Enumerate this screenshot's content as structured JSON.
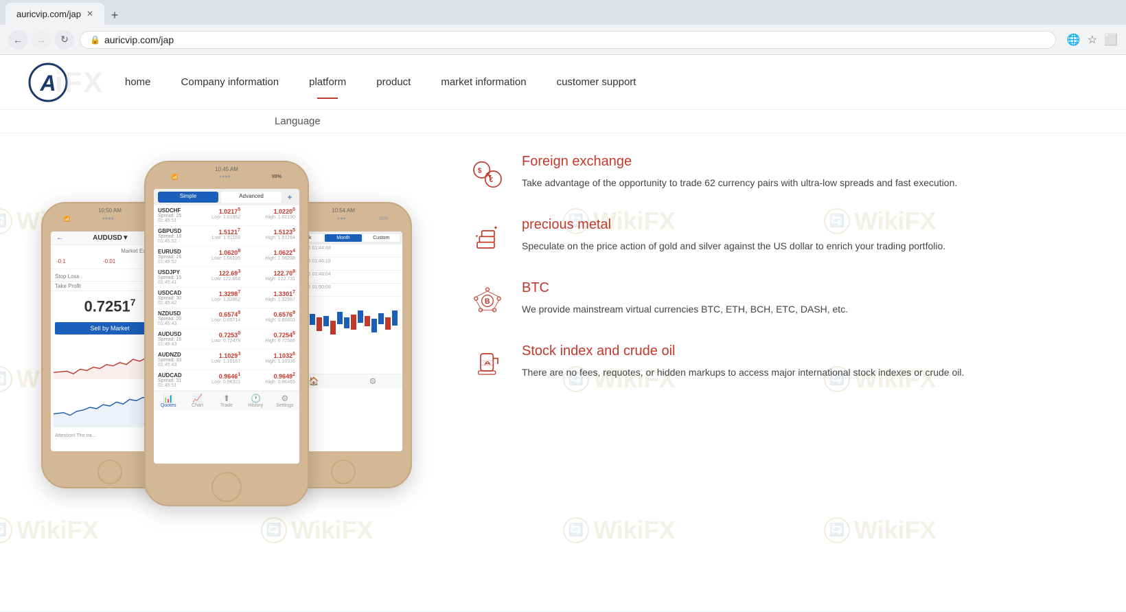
{
  "browser": {
    "url": "auricvip.com/jap",
    "tab_title": "auricvip.com/jap"
  },
  "nav": {
    "logo_letter": "A",
    "logo_bg_text": "iFX",
    "links": [
      {
        "label": "home",
        "active": false
      },
      {
        "label": "Company information",
        "active": false
      },
      {
        "label": "platform",
        "active": true
      },
      {
        "label": "product",
        "active": false
      },
      {
        "label": "market information",
        "active": false
      },
      {
        "label": "customer support",
        "active": false
      }
    ],
    "language_label": "Language"
  },
  "features": [
    {
      "id": "foreign-exchange",
      "title": "Foreign exchange",
      "description": "Take advantage of the opportunity to trade 62 currency pairs with ultra-low spreads and fast execution.",
      "icon": "exchange"
    },
    {
      "id": "precious-metal",
      "title": "precious metal",
      "description": "Speculate on the price action of gold and silver against the US dollar to enrich your trading portfolio.",
      "icon": "gold"
    },
    {
      "id": "btc",
      "title": "BTC",
      "description": "We provide mainstream virtual currencies BTC, ETH, BCH, ETC, DASH, etc.",
      "icon": "bitcoin"
    },
    {
      "id": "stock-index",
      "title": "Stock index and crude oil",
      "description": "There are no fees, requotes, or hidden markups to access major international stock indexes or crude oil.",
      "icon": "oil"
    }
  ],
  "phones": {
    "left": {
      "time": "10:50 AM",
      "pair": "AUDUSD▼",
      "execution": "Market Execution",
      "price": "0.7251",
      "sup": "7",
      "stop_loss": "—",
      "take_profit": "—",
      "sell_btn": "Sell by Market",
      "attention": "Attention! The tra..."
    },
    "center": {
      "time": "10:45 AM",
      "tabs": [
        "Simple",
        "Advanced"
      ],
      "pairs": [
        {
          "name": "USDCHF",
          "spread": 25,
          "time": "01:45:51",
          "bid": "1.0217",
          "bid_sup": "5",
          "ask": "1.0220",
          "ask_sup": "0",
          "low": "1.01952",
          "high": "1.02190"
        },
        {
          "name": "GBPUSD",
          "spread": 18,
          "time": "01:45:52",
          "bid": "1.5121",
          "bid_sup": "7",
          "ask": "1.5123",
          "ask_sup": "5",
          "low": "1.51169",
          "high": "1.51264"
        },
        {
          "name": "EURUSD",
          "spread": 16,
          "time": "01:45:52",
          "bid": "1.0620",
          "bid_sup": "8",
          "ask": "1.0622",
          "ask_sup": "4",
          "low": "1.06105",
          "high": "1.06238"
        },
        {
          "name": "USDJPY",
          "spread": 15,
          "time": "01:45:41",
          "bid": "122.69",
          "bid_sup": "3",
          "ask": "122.70",
          "ask_sup": "8",
          "low": "122.668",
          "high": "122.731"
        },
        {
          "name": "USDCAD",
          "spread": 30,
          "time": "01:45:42",
          "bid": "1.3298",
          "bid_sup": "7",
          "ask": "1.3301",
          "ask_sup": "7",
          "low": "1.32862",
          "high": "1.32987"
        },
        {
          "name": "NZDUSD",
          "spread": 20,
          "time": "01:45:43",
          "bid": "0.6574",
          "bid_sup": "8",
          "ask": "0.6576",
          "ask_sup": "8",
          "low": "0.65714",
          "high": "0.65803"
        },
        {
          "name": "AUDUSD",
          "spread": 16,
          "time": "01:45:43",
          "bid": "0.7253",
          "bid_sup": "0",
          "ask": "0.7254",
          "ask_sup": "6",
          "low": "0.72478",
          "high": "0.72566"
        },
        {
          "name": "AUDNZD",
          "spread": 33,
          "time": "01:45:43",
          "bid": "1.1029",
          "bid_sup": "3",
          "ask": "1.1032",
          "ask_sup": "6",
          "low": "1.10167",
          "high": "1.10336"
        },
        {
          "name": "AUDCAD",
          "spread": 31,
          "time": "01:45:51",
          "bid": "0.9646",
          "bid_sup": "1",
          "ask": "0.9649",
          "ask_sup": "2",
          "low": "0.96321",
          "high": "0.96465"
        }
      ],
      "bottom_tabs": [
        "Quotes",
        "Chart",
        "Trade",
        "History",
        "Settings"
      ]
    },
    "right": {
      "time": "10:54 AM",
      "chart_tabs": [
        "Week",
        "Month",
        "Custom"
      ],
      "active_tab": "Month"
    }
  },
  "wikifx": {
    "watermark": "WikiFX"
  }
}
